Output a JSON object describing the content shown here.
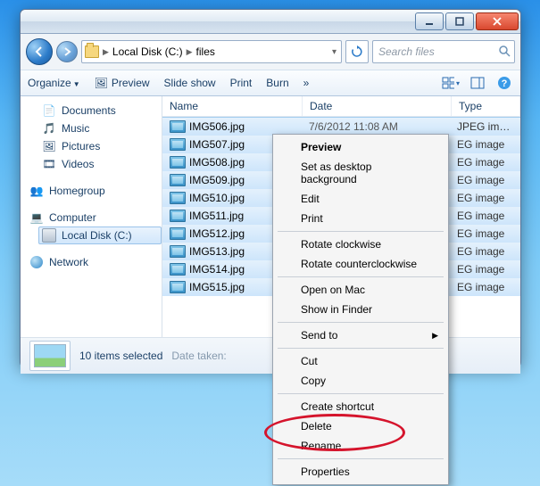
{
  "breadcrumb": {
    "seg1": "Local Disk (C:)",
    "seg2": "files"
  },
  "search": {
    "placeholder": "Search files"
  },
  "toolbar": {
    "organize": "Organize",
    "preview": "Preview",
    "slideshow": "Slide show",
    "print": "Print",
    "burn": "Burn"
  },
  "sidebar": {
    "documents": "Documents",
    "music": "Music",
    "pictures": "Pictures",
    "videos": "Videos",
    "homegroup": "Homegroup",
    "computer": "Computer",
    "localdisk": "Local Disk (C:)",
    "network": "Network"
  },
  "columns": {
    "name": "Name",
    "date": "Date",
    "type": "Type"
  },
  "file_date": "7/6/2012 11:08 AM",
  "type_full": "JPEG image",
  "type_short": "EG image",
  "files": [
    {
      "name": "IMG506.jpg"
    },
    {
      "name": "IMG507.jpg"
    },
    {
      "name": "IMG508.jpg"
    },
    {
      "name": "IMG509.jpg"
    },
    {
      "name": "IMG510.jpg"
    },
    {
      "name": "IMG511.jpg"
    },
    {
      "name": "IMG512.jpg"
    },
    {
      "name": "IMG513.jpg"
    },
    {
      "name": "IMG514.jpg"
    },
    {
      "name": "IMG515.jpg"
    }
  ],
  "footer": {
    "count": "10 items selected",
    "date_label": "Date taken:"
  },
  "ctx": {
    "preview": "Preview",
    "setbg": "Set as desktop background",
    "edit": "Edit",
    "print": "Print",
    "rotcw": "Rotate clockwise",
    "rotccw": "Rotate counterclockwise",
    "openmac": "Open on Mac",
    "finder": "Show in Finder",
    "sendto": "Send to",
    "cut": "Cut",
    "copy": "Copy",
    "shortcut": "Create shortcut",
    "delete": "Delete",
    "rename": "Rename",
    "props": "Properties"
  }
}
